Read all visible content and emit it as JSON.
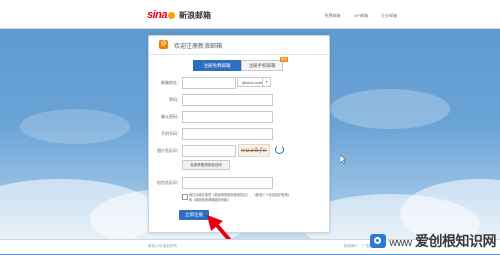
{
  "header": {
    "logo_mark": "sina",
    "logo_text": "新浪邮箱",
    "links": [
      "免费邮箱",
      "VIP邮箱",
      "企业邮箱"
    ]
  },
  "card": {
    "title": "欢迎注册新浪邮箱",
    "tabs": [
      {
        "label": "注册免费邮箱",
        "active": true
      },
      {
        "label": "注册手机邮箱",
        "active": false,
        "badge": "免费"
      }
    ],
    "fields": [
      {
        "label": "邮箱地址：",
        "value": "",
        "domain": "@sina.com"
      },
      {
        "label": "密码：",
        "value": ""
      },
      {
        "label": "确认密码：",
        "value": ""
      },
      {
        "label": "手机号码：",
        "value": ""
      },
      {
        "label": "图片验证码：",
        "value": "",
        "captcha": "xuabfc"
      },
      {
        "label": "短信验证码：",
        "value": ""
      }
    ],
    "sms_button": "免费获取短信验证码",
    "agreement_line1": "我已阅读并接受《新浪网络服务使用协议》、《新浪个人信息保护政策》",
    "agreement_line2": "和《新浪免费邮箱服务条款》",
    "submit": "立即注册"
  },
  "footer": {
    "left": "新浪公司 版权所有",
    "right": [
      "新浪简介",
      "广告服务"
    ]
  },
  "watermark": {
    "text": "爱创根知识网",
    "domain": "www"
  },
  "colors": {
    "brand_red": "#e60012",
    "accent_blue": "#2c6fbf",
    "orange": "#f08300"
  }
}
